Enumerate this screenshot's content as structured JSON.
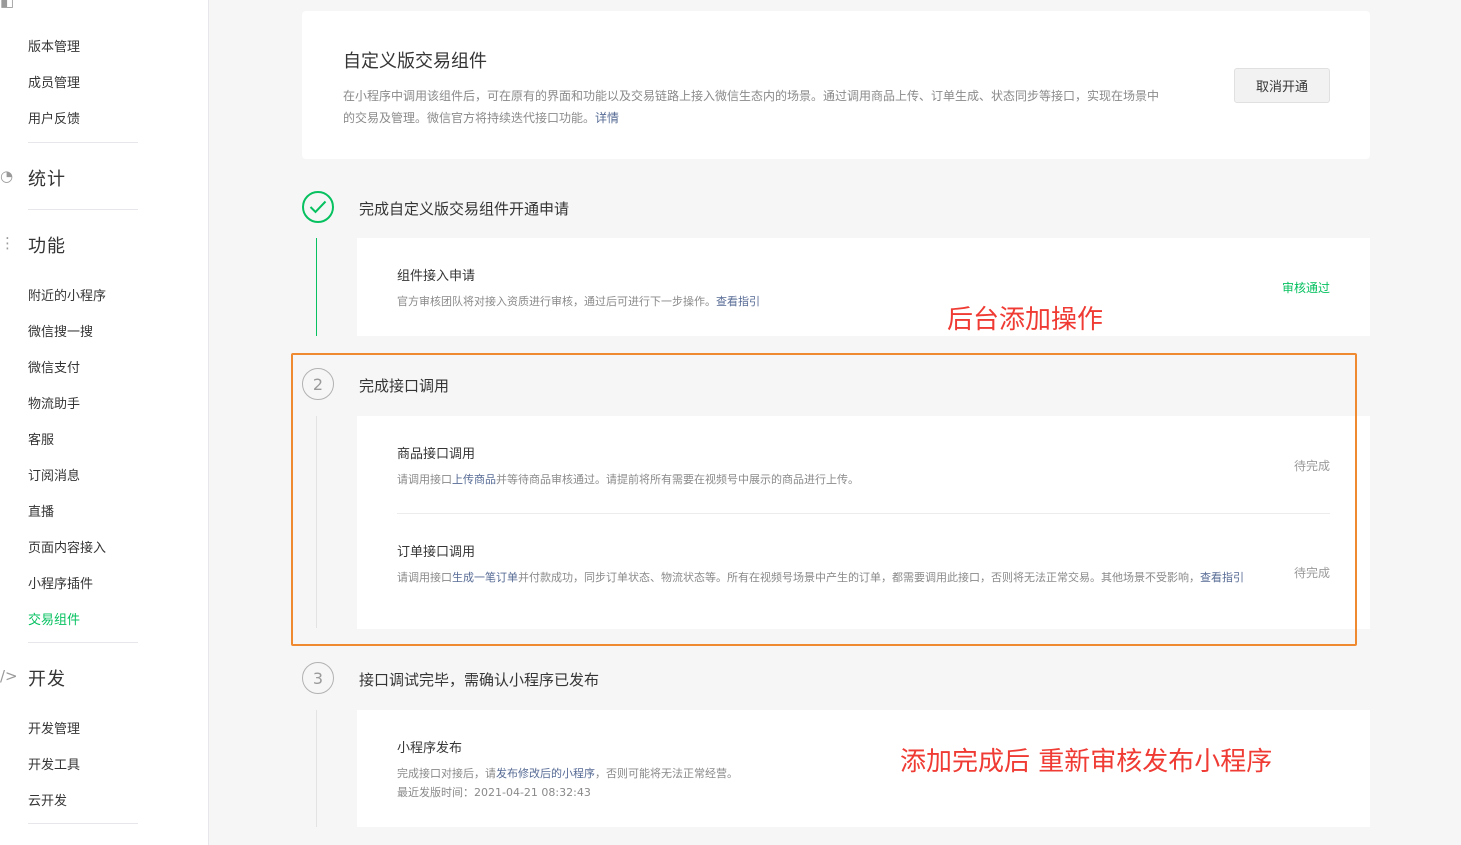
{
  "sidebar": {
    "top_items": [
      "版本管理",
      "成员管理",
      "用户反馈"
    ],
    "sections": [
      {
        "title": "统计",
        "items": []
      },
      {
        "title": "功能",
        "items": [
          "附近的小程序",
          "微信搜一搜",
          "微信支付",
          "物流助手",
          "客服",
          "订阅消息",
          "直播",
          "页面内容接入",
          "小程序插件",
          "交易组件"
        ]
      },
      {
        "title": "开发",
        "items": [
          "开发管理",
          "开发工具",
          "云开发"
        ]
      }
    ],
    "active_item": "交易组件"
  },
  "header": {
    "title": "自定义版交易组件",
    "desc": "在小程序中调用该组件后，可在原有的界面和功能以及交易链路上接入微信生态内的场景。通过调用商品上传、订单生成、状态同步等接口，实现在场景中的交易及管理。微信官方将持续迭代接口功能。",
    "desc_link": "详情",
    "cancel_button": "取消开通"
  },
  "steps": [
    {
      "number": "",
      "title": "完成自定义版交易组件开通申请",
      "done": true,
      "items": [
        {
          "title": "组件接入申请",
          "desc": "官方审核团队将对接入资质进行审核，通过后可进行下一步操作。",
          "link": "查看指引",
          "status": "审核通过"
        }
      ]
    },
    {
      "number": "2",
      "title": "完成接口调用",
      "done": false,
      "items": [
        {
          "title": "商品接口调用",
          "desc_pre": "请调用接口",
          "link": "上传商品",
          "desc_post": "并等待商品审核通过。请提前将所有需要在视频号中展示的商品进行上传。",
          "status": "待完成"
        },
        {
          "title": "订单接口调用",
          "desc_pre": "请调用接口",
          "link": "生成一笔订单",
          "desc_post": "并付款成功，同步订单状态、物流状态等。所有在视频号场景中产生的订单，都需要调用此接口，否则将无法正常交易。其他场景不受影响，",
          "link2": "查看指引",
          "status": "待完成"
        }
      ]
    },
    {
      "number": "3",
      "title": "接口调试完毕，需确认小程序已发布",
      "done": false,
      "items": [
        {
          "title": "小程序发布",
          "desc_pre": "完成接口对接后，请",
          "link": "发布修改后的小程序",
          "desc_post": "，否则可能将无法正常经营。",
          "desc_line2": "最近发版时间：2021-04-21 08:32:43"
        }
      ]
    }
  ],
  "annotations": {
    "backend": "后台添加操作",
    "republish": "添加完成后 重新审核发布小程序"
  },
  "colors": {
    "accent_green": "#07c160",
    "link": "#576b95",
    "annotation_red": "#ef3b33",
    "highlight_orange": "#f08a30"
  }
}
